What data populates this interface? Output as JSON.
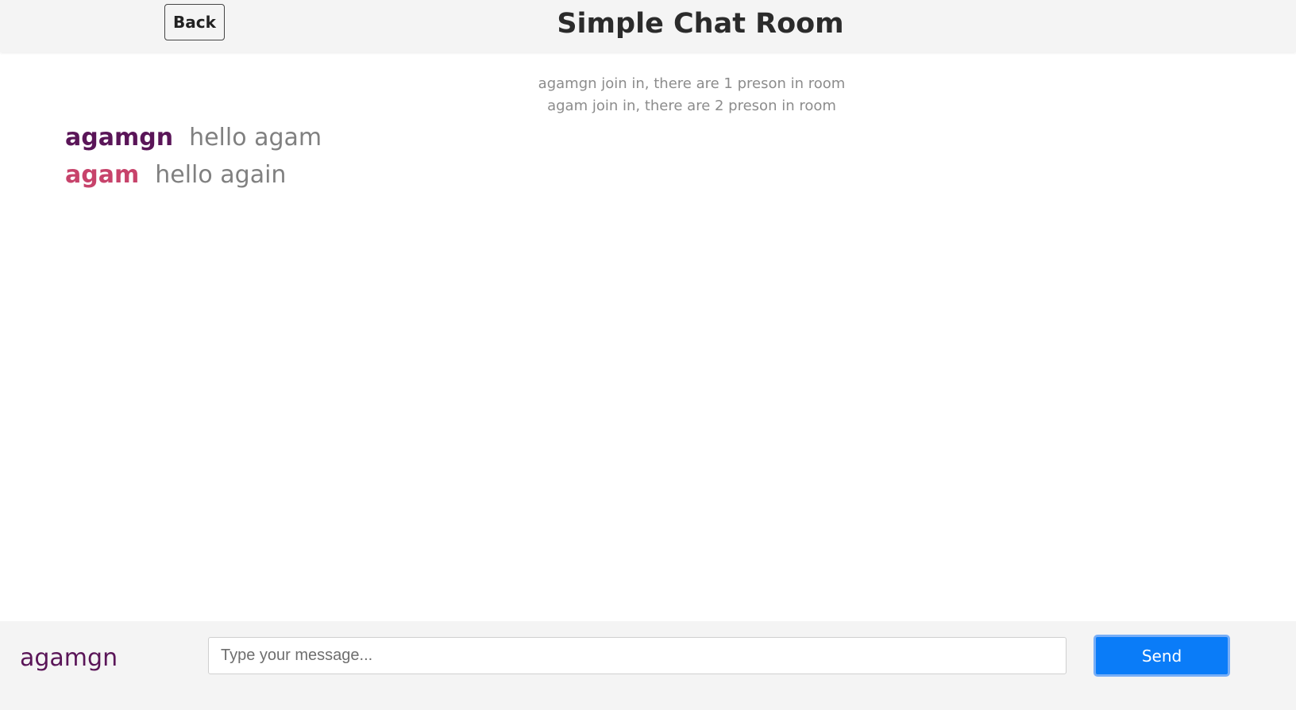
{
  "header": {
    "back_label": "Back",
    "title": "Simple Chat Room"
  },
  "notices": [
    "agamgn join in, there are 1 preson in room",
    "agam join in, there are 2 preson in room"
  ],
  "messages": [
    {
      "user": "agamgn",
      "text": "hello agam",
      "user_color": "#5a1558"
    },
    {
      "user": "agam",
      "text": "hello again",
      "user_color": "#c7436b"
    }
  ],
  "footer": {
    "current_user": "agamgn",
    "input_value": "",
    "input_placeholder": "Type your message...",
    "send_label": "Send"
  },
  "colors": {
    "header_bg": "#f4f4f4",
    "footer_bg": "#f4f4f4",
    "send_button": "#0a7cf8",
    "notice_text": "#8c8c8c",
    "message_text": "#808080"
  }
}
